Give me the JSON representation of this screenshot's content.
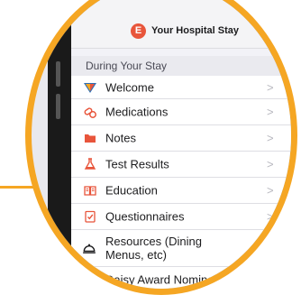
{
  "header": {
    "logo_letter": "E",
    "title": "Your Hospital Stay"
  },
  "section": {
    "title": "During Your Stay"
  },
  "menu": [
    {
      "label": "Welcome",
      "icon": "welcome-logo-icon"
    },
    {
      "label": "Medications",
      "icon": "pills-icon"
    },
    {
      "label": "Notes",
      "icon": "folder-icon"
    },
    {
      "label": "Test Results",
      "icon": "flask-icon"
    },
    {
      "label": "Education",
      "icon": "book-icon"
    },
    {
      "label": "Questionnaires",
      "icon": "checklist-icon"
    },
    {
      "label": "Resources (Dining Menus, etc)",
      "icon": "dining-cloche-icon"
    },
    {
      "label": "Daisy Award Nomination",
      "icon": "award-icon"
    }
  ],
  "chevron": ">",
  "colors": {
    "frame": "#f5a623",
    "accent": "#e8553b",
    "header_edge": "#4a7fc1"
  }
}
